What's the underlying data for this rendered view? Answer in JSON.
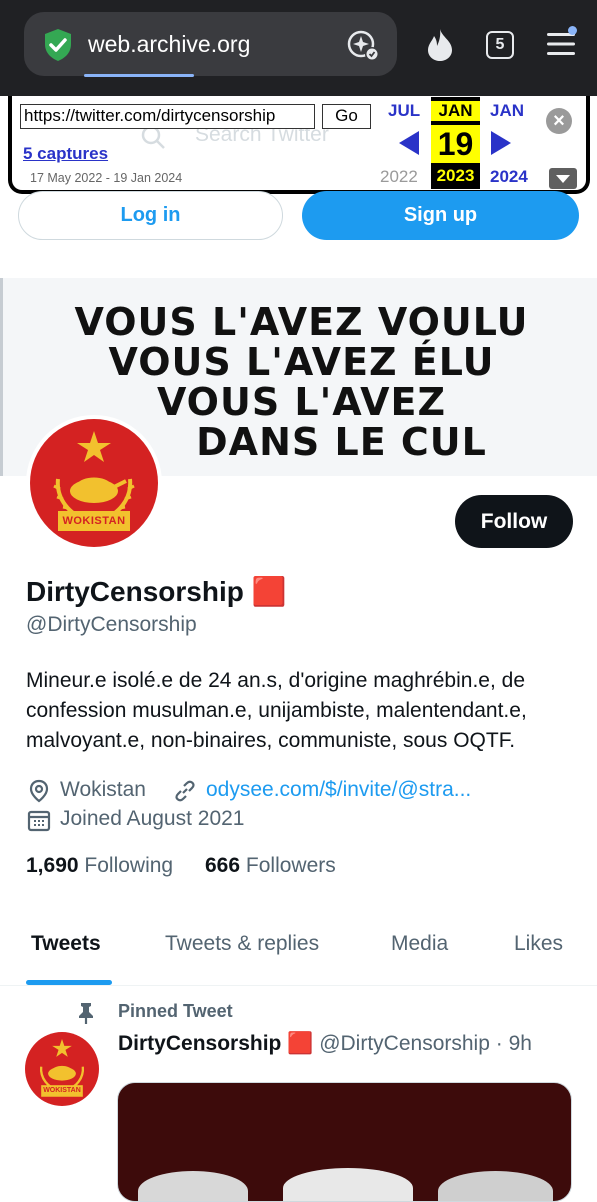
{
  "browser": {
    "url": "web.archive.org",
    "tab_count": "5"
  },
  "wayback": {
    "url_value": "https://twitter.com/dirtycensorship",
    "go_label": "Go",
    "captures": "5 captures",
    "date_range": "17 May 2022 - 19 Jan 2024",
    "prev_month": "JUL",
    "prev_year": "2022",
    "current_month": "JAN",
    "current_day": "19",
    "current_year": "2023",
    "next_month": "JAN",
    "next_year": "2024",
    "ghost_search": "Search Twitter"
  },
  "auth": {
    "login": "Log in",
    "signup": "Sign up"
  },
  "banner": {
    "lines": [
      "VOUS L'AVEZ VOULU",
      "VOUS L'AVEZ ÉLU",
      "VOUS L'AVEZ",
      "DANS LE CUL"
    ]
  },
  "avatar": {
    "caption": "WOKISTAN"
  },
  "profile": {
    "follow": "Follow",
    "display_name": "DirtyCensorship 🟥",
    "handle": "@DirtyCensorship",
    "bio": "Mineur.e isolé.e de 24 an.s, d'origine maghrébin.e, de confession musulman.e, unijambiste, malentendant.e, malvoyant.e, non-binaires, communiste, sous OQTF.",
    "location": "Wokistan",
    "link": "odysee.com/$/invite/@stra...",
    "joined": "Joined August 2021",
    "following_count": "1,690",
    "following_label": "Following",
    "followers_count": "666",
    "followers_label": "Followers"
  },
  "tabs": [
    "Tweets",
    "Tweets & replies",
    "Media",
    "Likes"
  ],
  "pinned": {
    "label": "Pinned Tweet",
    "author_name": "DirtyCensorship 🟥",
    "author_handle": "@DirtyCensorship",
    "time": "· 9h"
  },
  "colors": {
    "twitter_blue": "#1d9bf0",
    "wayback_blue": "#2a33c8",
    "highlight_yellow": "#ffff00",
    "avatar_red": "#d42222"
  }
}
